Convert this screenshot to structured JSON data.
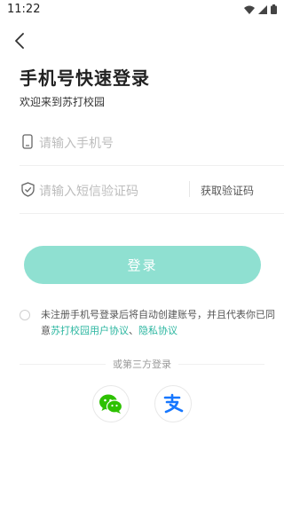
{
  "status": {
    "time": "11:22"
  },
  "header": {
    "title": "手机号快速登录",
    "subtitle": "欢迎来到苏打校园"
  },
  "form": {
    "phone_placeholder": "请输入手机号",
    "code_placeholder": "请输入短信验证码",
    "get_code_label": "获取验证码",
    "login_label": "登录"
  },
  "agreement": {
    "text_1": "未注册手机号登录后将自动创建账号，并且代表你已同意",
    "user_agreement": "苏打校园用户协议",
    "separator": "、",
    "privacy": "隐私协议"
  },
  "third_party": {
    "title": "或第三方登录"
  },
  "colors": {
    "accent": "#2bb6a0",
    "button": "#8fe0d1",
    "wechat": "#2dc100",
    "alipay": "#1677ff"
  },
  "icons": [
    "back-arrow-icon",
    "phone-icon",
    "shield-check-icon",
    "wechat-icon",
    "alipay-icon",
    "wifi-icon",
    "signal-icon",
    "battery-icon"
  ]
}
